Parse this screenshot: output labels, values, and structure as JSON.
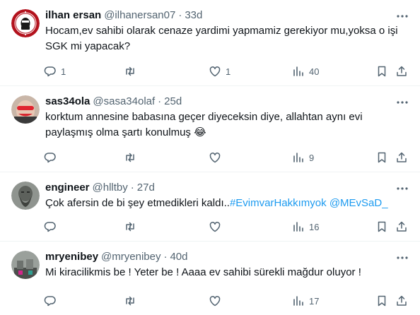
{
  "tweets": [
    {
      "name": "ilhan ersan",
      "handle": "@ilhanersan07",
      "dot": "·",
      "time": "33d",
      "text": "Hocam,ev sahibi olarak cenaze yardimi yapmamiz gerekiyor mu,yoksa o işi SGK mi yapacak?",
      "replies": "1",
      "retweets": "",
      "likes": "1",
      "views": "40"
    },
    {
      "name": "sas34ola",
      "handle": "@sasa34olaf",
      "dot": "·",
      "time": "25d",
      "text": "korktum annesine babasına geçer diyeceksin diye, allahtan aynı evi paylaşmış olma şartı konulmuş 😂",
      "replies": "",
      "retweets": "",
      "likes": "",
      "views": "9"
    },
    {
      "name": "engineer",
      "handle": "@hlltby",
      "dot": "·",
      "time": "27d",
      "text": "Çok afersin de bi şey etmedikleri kaldı..",
      "hashtag": "#EvimvarHakkımyok",
      "mention": "@MEvSaD_",
      "replies": "",
      "retweets": "",
      "likes": "",
      "views": "16"
    },
    {
      "name": "mryenibey",
      "handle": "@mryenibey",
      "dot": "·",
      "time": "40d",
      "text": "Mi kiracilikmis be ! Yeter be ! Aaaa ev sahibi sürekli mağdur oluyor !",
      "replies": "",
      "retweets": "",
      "likes": "",
      "views": "17"
    }
  ],
  "colors": {
    "text": "#0f1419",
    "secondary": "#536471",
    "link": "#1d9bf0",
    "divider": "#eff3f4"
  }
}
